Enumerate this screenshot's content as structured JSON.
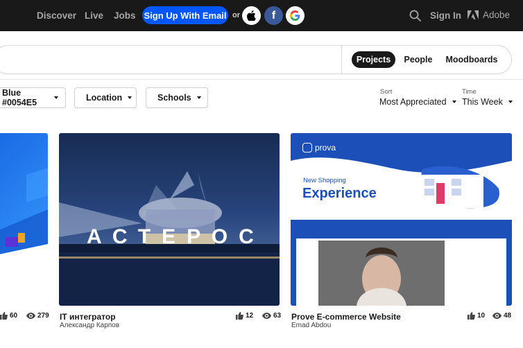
{
  "nav": {
    "discover": "Discover",
    "live": "Live",
    "jobs": "Jobs",
    "signup": "Sign Up With Email",
    "or": "or",
    "signin": "Sign In",
    "adobe": "Adobe"
  },
  "search": {
    "tabs": [
      "Projects",
      "People",
      "Moodboards"
    ],
    "active_tab": "Projects"
  },
  "filters": {
    "color": "Blue #0054E5",
    "location": "Location",
    "schools": "Schools"
  },
  "sort": {
    "label": "Sort",
    "value": "Most Appreciated"
  },
  "time": {
    "label": "Time",
    "value": "This Week"
  },
  "cards": [
    {
      "title": "",
      "owner": "",
      "likes": "60",
      "views": "279"
    },
    {
      "title": "IT интегратор",
      "owner": "Александр Карпов",
      "likes": "12",
      "views": "63",
      "overlay": "АСТЕРОС"
    },
    {
      "title": "Prove E-commerce Website",
      "owner": "Emad Abdou",
      "likes": "10",
      "views": "48",
      "brand": "prova",
      "tagline": "New Shopping",
      "headline": "Experience"
    }
  ],
  "colors": {
    "nav_bg": "#191919",
    "signup_blue": "#0057ff",
    "facebook": "#3b5998"
  }
}
